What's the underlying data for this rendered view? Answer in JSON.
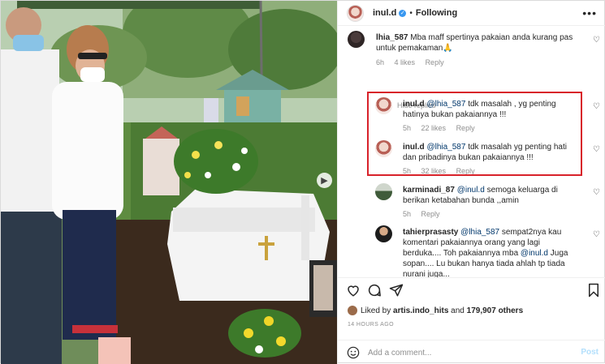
{
  "header": {
    "username": "inul.d",
    "dot": "•",
    "follow_label": "Following",
    "more": "•••"
  },
  "comments": [
    {
      "username": "lhia_587",
      "mention": "",
      "text": "Mba maff spertinya pakaian anda kurang pas untuk pemakaman🙏",
      "time": "6h",
      "likes": "4 likes",
      "reply": "Reply"
    },
    {
      "username": "inul.d",
      "mention": "@lhia_587",
      "text": "tdk masalah , yg penting hatinya bukan pakaiannya !!!",
      "time": "5h",
      "likes": "22 likes",
      "reply": "Reply"
    },
    {
      "username": "inul.d",
      "mention": "@lhia_587",
      "text": "tdk masalah yg penting hati dan pribadinya bukan pakaiannya !!!",
      "time": "5h",
      "likes": "32 likes",
      "reply": "Reply"
    },
    {
      "username": "karminadi_87",
      "mention": "@inul.d",
      "text": "semoga keluarga di berikan ketabahan bunda ,,amin",
      "time": "5h",
      "likes": "",
      "reply": "Reply"
    },
    {
      "username": "tahierprasasty",
      "mention": "@lhia_587",
      "text": "sempat2nya kau komentari pakaiannya orang yang lagi berduka.... Toh pakaiannya mba",
      "mention2": "@inul.d",
      "text2": "Juga sopan.... Lu bukan hanya tiada ahlah tp tiada nurani juga...",
      "time": "",
      "likes": "",
      "reply": ""
    }
  ],
  "hide_replies": "Hide replies",
  "likes_bar": {
    "prefix": "Liked by",
    "user": "artis.indo_hits",
    "and": "and",
    "count": "179,907 others"
  },
  "time_ago": "14 HOURS AGO",
  "add_comment": {
    "placeholder": "Add a comment...",
    "post_label": "Post"
  },
  "icons": {
    "heart": "heart-icon",
    "comment": "comment-icon",
    "share": "share-icon",
    "save": "bookmark-icon",
    "emoji": "emoji-icon",
    "next": "chevron-right-icon"
  }
}
